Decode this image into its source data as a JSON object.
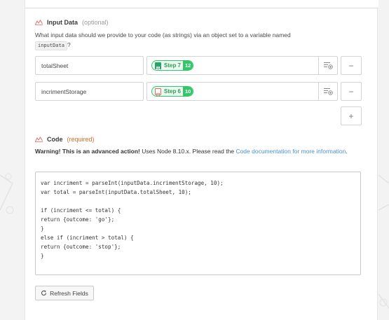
{
  "input_section": {
    "title": "Input Data",
    "qualifier": "(optional)",
    "description_before": "What input data should we provide to your code (as strings) via an object set to a variable named",
    "variable_name": "inputData",
    "description_after": "?"
  },
  "rows": [
    {
      "key": "totalSheet",
      "step_label": "Step 7",
      "step_number": "12",
      "app": "google-sheets-icon"
    },
    {
      "key": "incrimentStorage",
      "step_label": "Step 6",
      "step_number": "10",
      "app": "storage-icon"
    }
  ],
  "buttons": {
    "remove": "−",
    "add": "+",
    "refresh": "Refresh Fields"
  },
  "code_section": {
    "title": "Code",
    "qualifier": "(required)",
    "warning_bold": "Warning! This is an advanced action!",
    "warning_text": " Uses Node 8.10.x. Please read the ",
    "link_text": "Code documentation for more information",
    "warning_end": ".",
    "code": "var incriment = parseInt(inputData.incrimentStorage, 10);\nvar total = parseInt(inputData.totalSheet, 10);\n\nif (incriment <= total) {\nreturn {outcome: 'go'};\n}\nelse if (incriment > total) {\nreturn {outcome: 'stop'};\n}"
  },
  "colors": {
    "accent_green": "#35c66a",
    "link_blue": "#4a90d9",
    "required_orange": "#e06e2e"
  }
}
